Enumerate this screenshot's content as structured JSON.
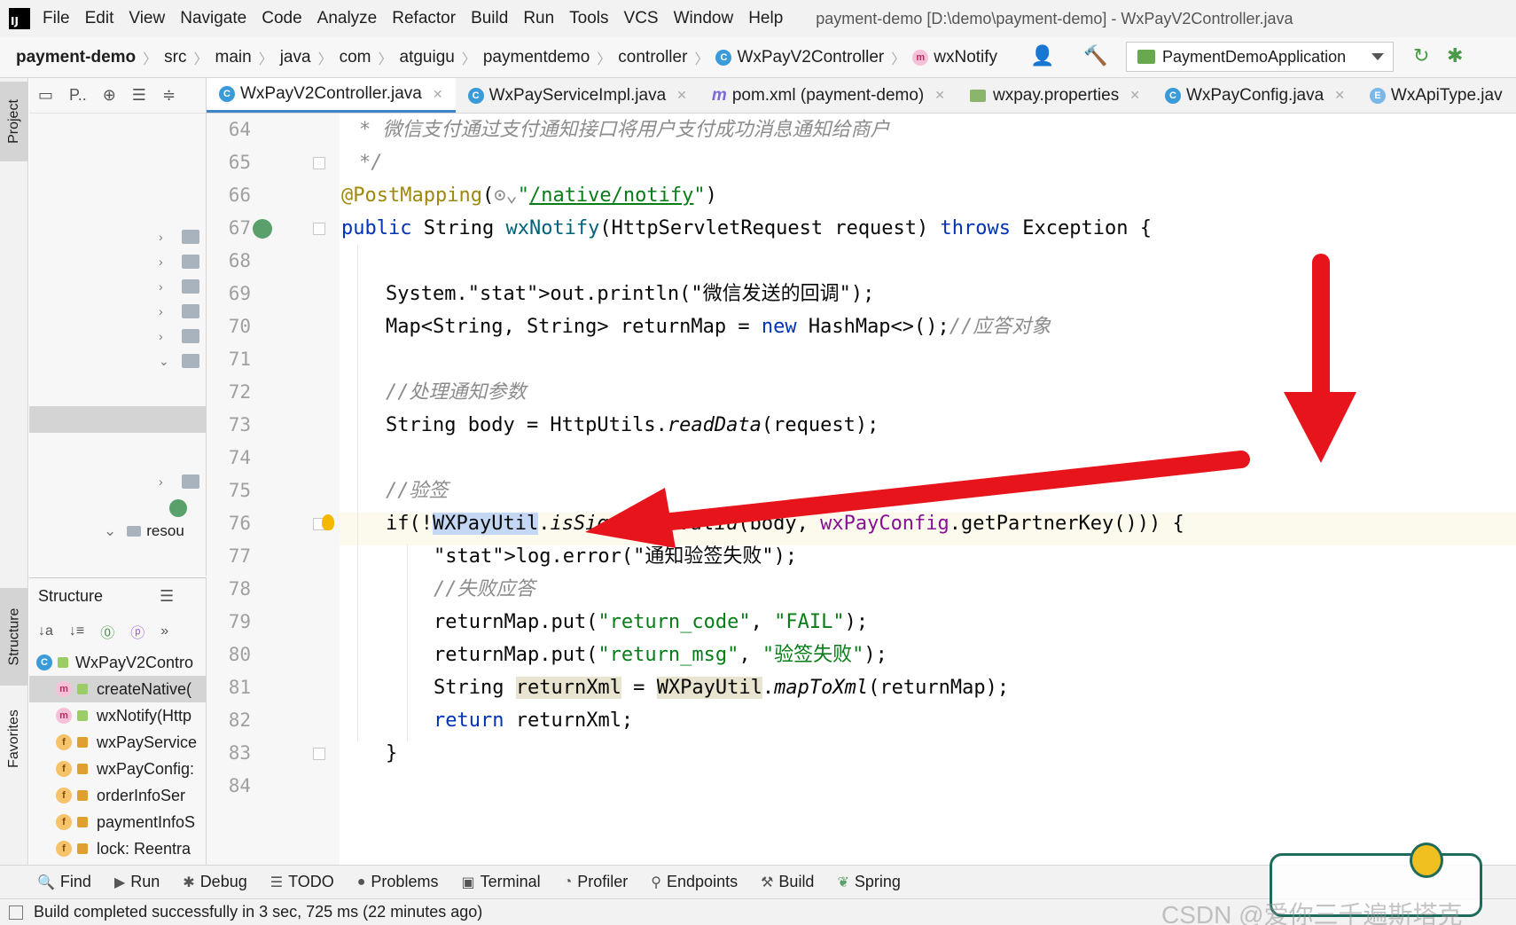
{
  "window": {
    "title": "payment-demo [D:\\demo\\payment-demo] - WxPayV2Controller.java",
    "menu": [
      "File",
      "Edit",
      "View",
      "Navigate",
      "Code",
      "Analyze",
      "Refactor",
      "Build",
      "Run",
      "Tools",
      "VCS",
      "Window",
      "Help"
    ]
  },
  "navbar": {
    "breadcrumbs": [
      "payment-demo",
      "src",
      "main",
      "java",
      "com",
      "atguigu",
      "paymentdemo",
      "controller",
      "WxPayV2Controller",
      "wxNotify"
    ],
    "run_config": "PaymentDemoApplication"
  },
  "left_stripe": {
    "project": "Project",
    "structure": "Structure",
    "favorites": "Favorites"
  },
  "project_panel": {
    "label": "P..",
    "partial_item": "resou"
  },
  "structure_panel": {
    "title": "Structure",
    "items": [
      {
        "icon": "c",
        "label": "WxPayV2Contro"
      },
      {
        "icon": "m",
        "label": "createNative("
      },
      {
        "icon": "m",
        "label": "wxNotify(Http"
      },
      {
        "icon": "f",
        "label": "wxPayService"
      },
      {
        "icon": "f",
        "label": "wxPayConfig:"
      },
      {
        "icon": "f",
        "label": "orderInfoSer"
      },
      {
        "icon": "f",
        "label": "paymentInfoS"
      },
      {
        "icon": "f",
        "label": "lock: Reentra"
      }
    ]
  },
  "editor_tabs": [
    {
      "label": "WxPayV2Controller.java",
      "icon": "c",
      "active": true
    },
    {
      "label": "WxPayServiceImpl.java",
      "icon": "c",
      "active": false
    },
    {
      "label": "pom.xml (payment-demo)",
      "icon": "m",
      "active": false
    },
    {
      "label": "wxpay.properties",
      "icon": "prop",
      "active": false
    },
    {
      "label": "WxPayConfig.java",
      "icon": "c",
      "active": false
    },
    {
      "label": "WxApiType.jav",
      "icon": "e",
      "active": false
    }
  ],
  "code_lines": [
    {
      "n": "64",
      "text": "* 微信支付通过支付通知接口将用户支付成功消息通知给商户"
    },
    {
      "n": "65",
      "text": "*/"
    },
    {
      "n": "66",
      "text": "@PostMapping(\"/native/notify\")"
    },
    {
      "n": "67",
      "text": "public String wxNotify(HttpServletRequest request) throws Exception {"
    },
    {
      "n": "68",
      "text": ""
    },
    {
      "n": "69",
      "text": "System.out.println(\"微信发送的回调\");"
    },
    {
      "n": "70",
      "text": "Map<String, String> returnMap = new HashMap<>();//应答对象"
    },
    {
      "n": "71",
      "text": ""
    },
    {
      "n": "72",
      "text": "//处理通知参数"
    },
    {
      "n": "73",
      "text": "String body = HttpUtils.readData(request);"
    },
    {
      "n": "74",
      "text": ""
    },
    {
      "n": "75",
      "text": "//验签"
    },
    {
      "n": "76",
      "text": "if(!WXPayUtil.isSignatureValid(body, wxPayConfig.getPartnerKey())) {"
    },
    {
      "n": "77",
      "text": "log.error(\"通知验签失败\");"
    },
    {
      "n": "78",
      "text": "//失败应答"
    },
    {
      "n": "79",
      "text": "returnMap.put(\"return_code\", \"FAIL\");"
    },
    {
      "n": "80",
      "text": "returnMap.put(\"return_msg\", \"验签失败\");"
    },
    {
      "n": "81",
      "text": "String returnXml = WXPayUtil.mapToXml(returnMap);"
    },
    {
      "n": "82",
      "text": "return returnXml;"
    },
    {
      "n": "83",
      "text": "}"
    },
    {
      "n": "84",
      "text": ""
    }
  ],
  "bottom_tools": [
    "Find",
    "Run",
    "Debug",
    "TODO",
    "Problems",
    "Terminal",
    "Profiler",
    "Endpoints",
    "Build",
    "Spring"
  ],
  "status": {
    "message": "Build completed successfully in 3 sec, 725 ms (22 minutes ago)"
  },
  "watermark": "CSDN @爱你三千遍斯塔克",
  "colors": {
    "arrow": "#e8141c",
    "active_tab_underline": "#4083c9",
    "selection": "#c4d8f5",
    "keyword": "#0033b3",
    "string": "#067d17"
  }
}
